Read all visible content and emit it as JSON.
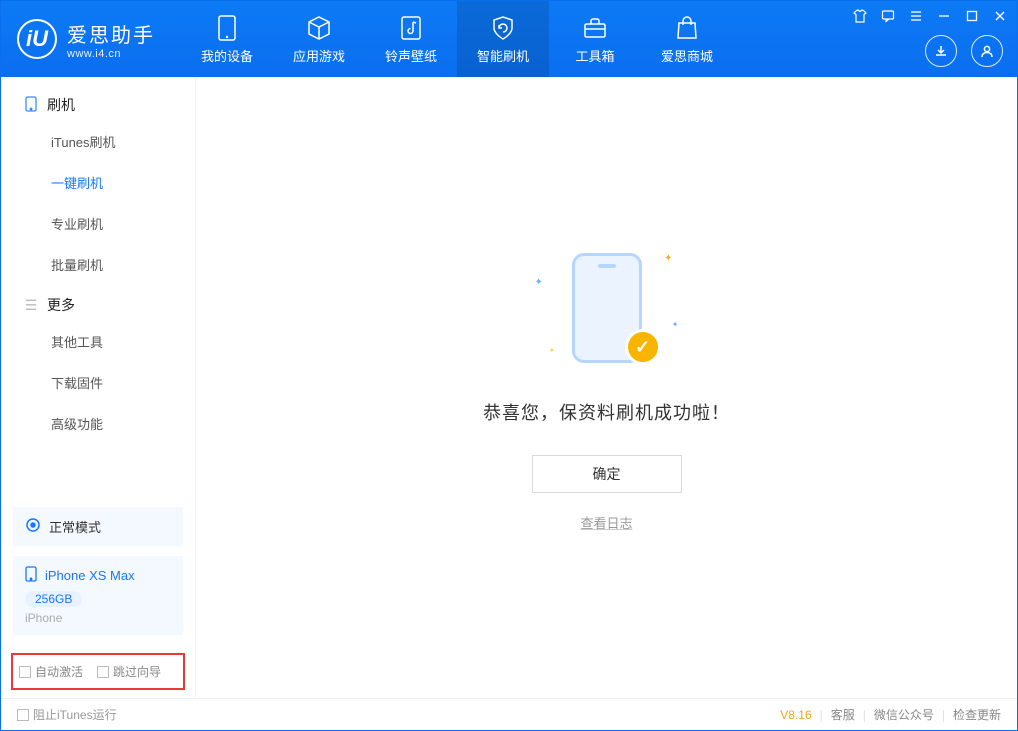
{
  "app": {
    "name": "爱思助手",
    "url": "www.i4.cn"
  },
  "tabs": [
    {
      "label": "我的设备"
    },
    {
      "label": "应用游戏"
    },
    {
      "label": "铃声壁纸"
    },
    {
      "label": "智能刷机"
    },
    {
      "label": "工具箱"
    },
    {
      "label": "爱思商城"
    }
  ],
  "active_tab_index": 3,
  "sidebar": {
    "groups": [
      {
        "title": "刷机",
        "icon": "device-icon",
        "items": [
          {
            "label": "iTunes刷机"
          },
          {
            "label": "一键刷机"
          },
          {
            "label": "专业刷机"
          },
          {
            "label": "批量刷机"
          }
        ],
        "active_index": 1
      },
      {
        "title": "更多",
        "icon": "menu-icon",
        "items": [
          {
            "label": "其他工具"
          },
          {
            "label": "下载固件"
          },
          {
            "label": "高级功能"
          }
        ],
        "active_index": -1
      }
    ],
    "mode_card": {
      "label": "正常模式"
    },
    "device_card": {
      "name": "iPhone XS Max",
      "storage": "256GB",
      "type": "iPhone"
    },
    "auto_options": {
      "activate": "自动激活",
      "skip_guide": "跳过向导"
    }
  },
  "main": {
    "success_message": "恭喜您，保资料刷机成功啦！",
    "ok_button": "确定",
    "view_log": "查看日志"
  },
  "footer": {
    "block_itunes": "阻止iTunes运行",
    "version": "V8.16",
    "links": [
      "客服",
      "微信公众号",
      "检查更新"
    ]
  }
}
